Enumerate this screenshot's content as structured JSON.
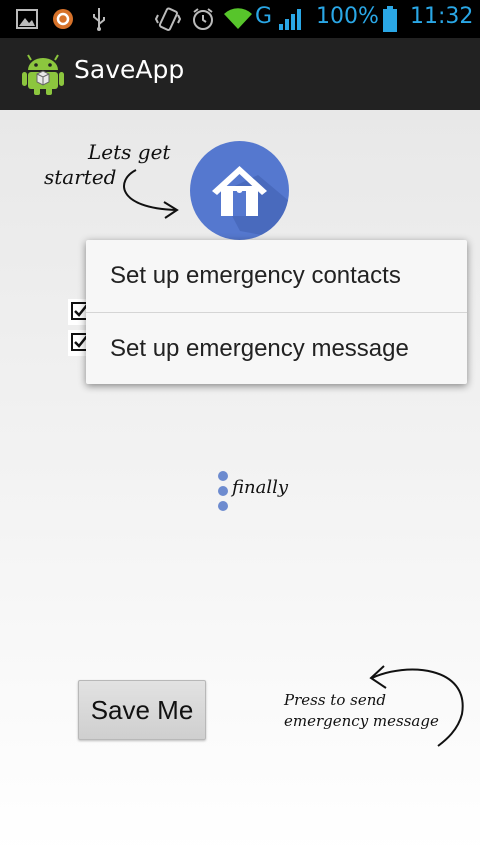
{
  "status_bar": {
    "battery_percent": "100%",
    "network": "G",
    "time": "11:32",
    "accent_color": "#2aa7e6",
    "icons": [
      "gallery-icon",
      "sync-icon",
      "usb-icon",
      "vibrate-icon",
      "alarm-icon",
      "wifi-icon",
      "signal-icon",
      "battery-icon"
    ]
  },
  "action_bar": {
    "app_icon": "android-icon",
    "title": "SaveApp"
  },
  "annotations": {
    "start_line1": "Lets get",
    "start_line2": "started",
    "finally": "finally",
    "send_line1": "Press to send",
    "send_line2": "emergency message"
  },
  "home_button": {
    "icon": "home-icon",
    "color": "#5578cf"
  },
  "popup_menu": {
    "items": [
      {
        "label": "Set up emergency contacts"
      },
      {
        "label": "Set up emergency message"
      }
    ]
  },
  "overflow_menu": {
    "icon": "overflow-dots-icon",
    "color": "#6d8bcf"
  },
  "save_button": {
    "label": "Save Me"
  }
}
